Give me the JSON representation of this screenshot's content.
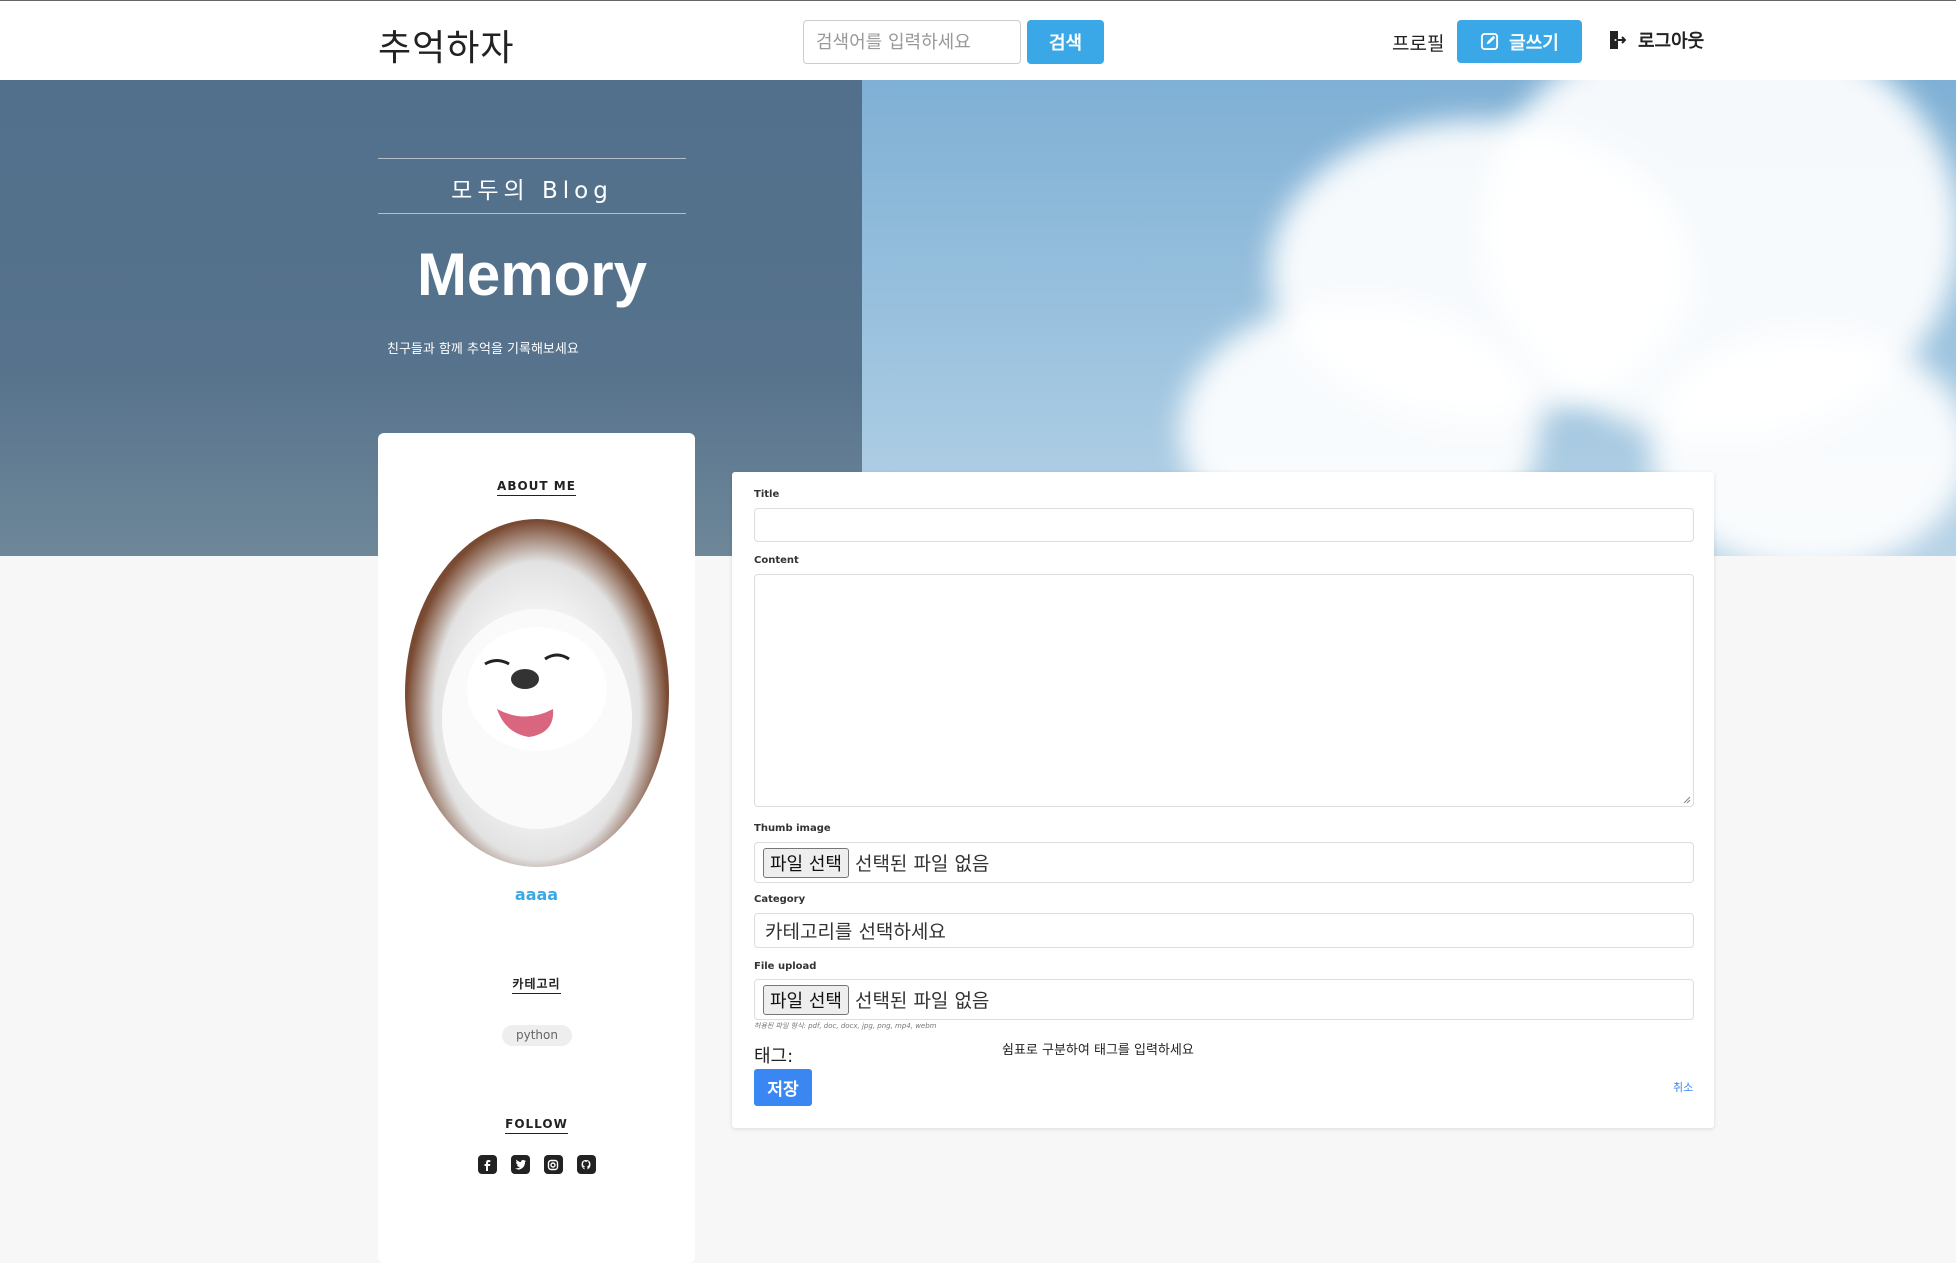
{
  "nav": {
    "brand": "추억하자",
    "search_placeholder": "검색어를 입력하세요",
    "search_button": "검색",
    "profile": "프로필",
    "write": "글쓰기",
    "logout": "로그아웃"
  },
  "hero": {
    "subtitle": "모두의 Blog",
    "title": "Memory",
    "description": "친구들과 함께 추억을 기록해보세요"
  },
  "sidebar": {
    "about_heading": "ABOUT ME",
    "username": "aaaa",
    "category_heading": "카테고리",
    "categories": [
      "python"
    ],
    "follow_heading": "FOLLOW",
    "socials": [
      "facebook-icon",
      "twitter-icon",
      "instagram-icon",
      "github-icon"
    ]
  },
  "form": {
    "title_label": "Title",
    "content_label": "Content",
    "thumb_label": "Thumb image",
    "file_button": "파일 선택",
    "no_file": "선택된 파일 없음",
    "category_label": "Category",
    "category_placeholder": "카테고리를 선택하세요",
    "upload_label": "File upload",
    "upload_hint": "허용된 파일 형식: pdf, doc, docx, jpg, png, mp4, webm",
    "tag_label": "태그:",
    "tag_placeholder": "쉼표로 구분하여 태그를 입력하세요",
    "save_button": "저장",
    "cancel": "취소"
  },
  "colors": {
    "accent": "#3aa8e6",
    "save": "#3a86f2",
    "hero_overlay": "#52708c"
  }
}
